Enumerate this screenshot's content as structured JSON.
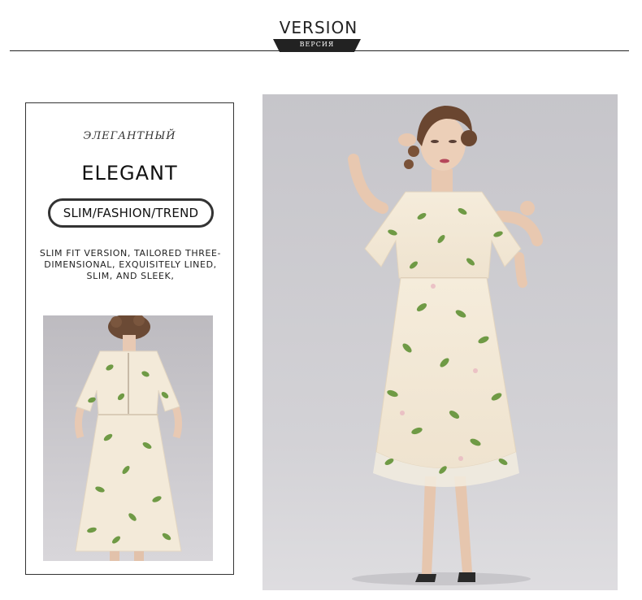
{
  "header": {
    "title": "VERSION",
    "tab_label": "ВЕРСИЯ"
  },
  "info_card": {
    "kicker": "ЭЛЕГАНТНЫЙ",
    "headline": "ELEGANT",
    "pill_text": "SLIM/FASHION/TREND",
    "description_lines": [
      "SLIM FIT VERSION, TAILORED THREE-",
      "DIMENSIONAL, EXQUISITELY LINED,",
      "SLIM, AND SLEEK,"
    ]
  },
  "colors": {
    "ink": "#222222",
    "dress": "#f3ead9",
    "leaf": "#6f9a45",
    "backdrop": "#cfcfd3"
  }
}
